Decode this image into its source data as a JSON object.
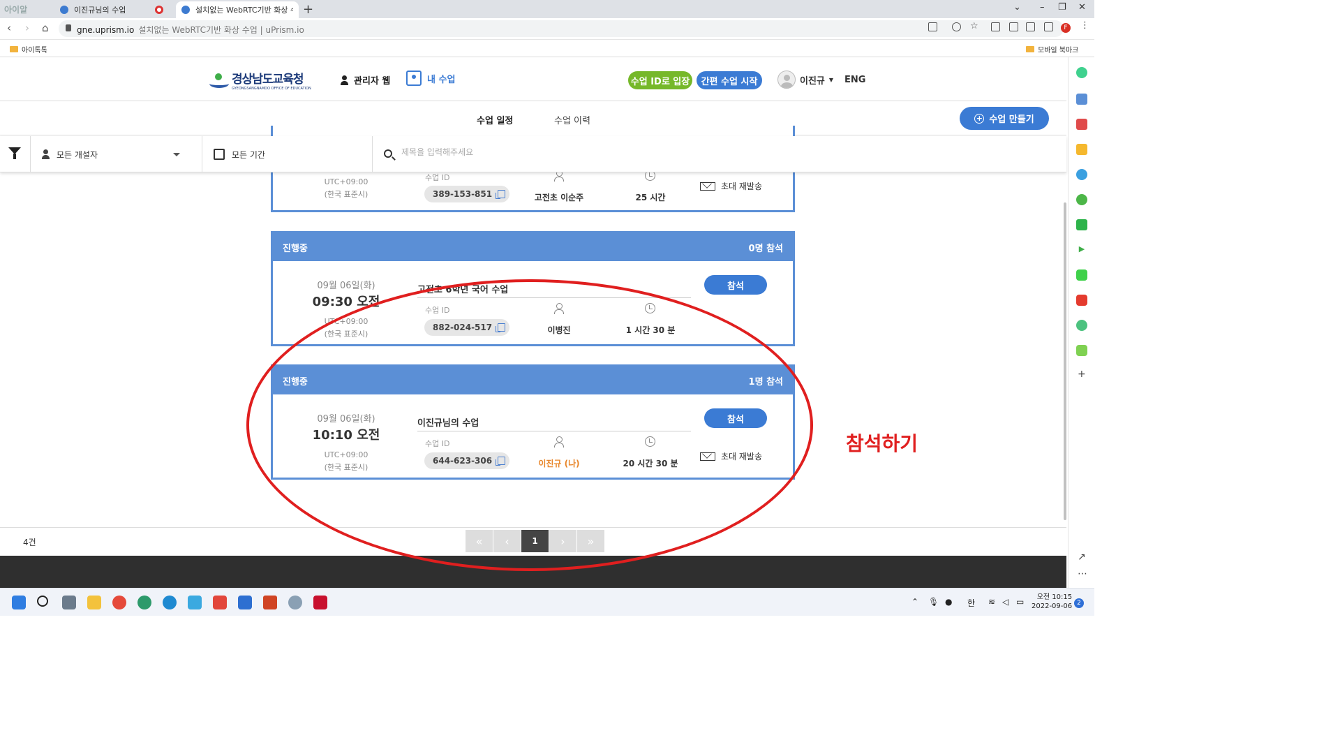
{
  "browser": {
    "ext_logo": "아이알",
    "tabs": [
      {
        "title": "이진규님의 수업"
      },
      {
        "title": "설치없는 WebRTC기반 화상 수업"
      }
    ],
    "url_domain": "gne.uprism.io",
    "url_title": "설치없는 WebRTC기반 화상 수업 | uPrism.io",
    "profile_initial": "F",
    "bookmarks": {
      "left": "아이톡톡",
      "right": "모바일 북마크"
    }
  },
  "header": {
    "logo_kr": "경상남도교육청",
    "logo_en": "GYEONGSANGNAMDO OFFICE OF EDUCATION",
    "admin_web": "관리자 웹",
    "my_class": "내 수업",
    "join_by_id": "수업 ID로 입장",
    "quick_start": "간편 수업 시작",
    "user_name": "이진규",
    "language": "ENG"
  },
  "tabs": {
    "schedule": "수업 일정",
    "history": "수업 이력",
    "create": "수업 만들기"
  },
  "filters": {
    "host": "모든 개설자",
    "period": "모든 기간",
    "search_placeholder": "제목을 입력해주세요"
  },
  "cards": [
    {
      "tz": "UTC+09:00",
      "tz_name": "(한국 표준시)",
      "id_label": "수업 ID",
      "class_id": "389-153-851",
      "host": "고전초 이순주",
      "duration": "25 시간",
      "resend": "초대 재발송"
    },
    {
      "status": "진행중",
      "participants": "0명 참석",
      "date": "09월 06일(화)",
      "time": "09:30 오전",
      "tz": "UTC+09:00",
      "tz_name": "(한국 표준시)",
      "title": "고전초 6학년 국어 수업",
      "id_label": "수업 ID",
      "class_id": "882-024-517",
      "host": "이병진",
      "duration": "1 시간 30 분",
      "join": "참석"
    },
    {
      "status": "진행중",
      "participants": "1명 참석",
      "date": "09월 06일(화)",
      "time": "10:10 오전",
      "tz": "UTC+09:00",
      "tz_name": "(한국 표준시)",
      "title": "이진규님의 수업",
      "id_label": "수업 ID",
      "class_id": "644-623-306",
      "host": "이진규 (나)",
      "duration": "20 시간 30 분",
      "join": "참석",
      "resend": "초대 재발송"
    }
  ],
  "pagination": {
    "total": "4건",
    "first": "«",
    "prev": "‹",
    "current": "1",
    "next": "›",
    "last": "»"
  },
  "annotation": {
    "note": "참석하기",
    "color": "#e01f1f"
  },
  "taskbar": {
    "ime": "한",
    "time": "오전 10:15",
    "date": "2022-09-06",
    "notifications": "2"
  },
  "colors": {
    "primary_blue": "#3b7bd4",
    "card_header": "#5b8fd6",
    "green_pill": "#76b82a",
    "own_host": "#e8862a"
  }
}
